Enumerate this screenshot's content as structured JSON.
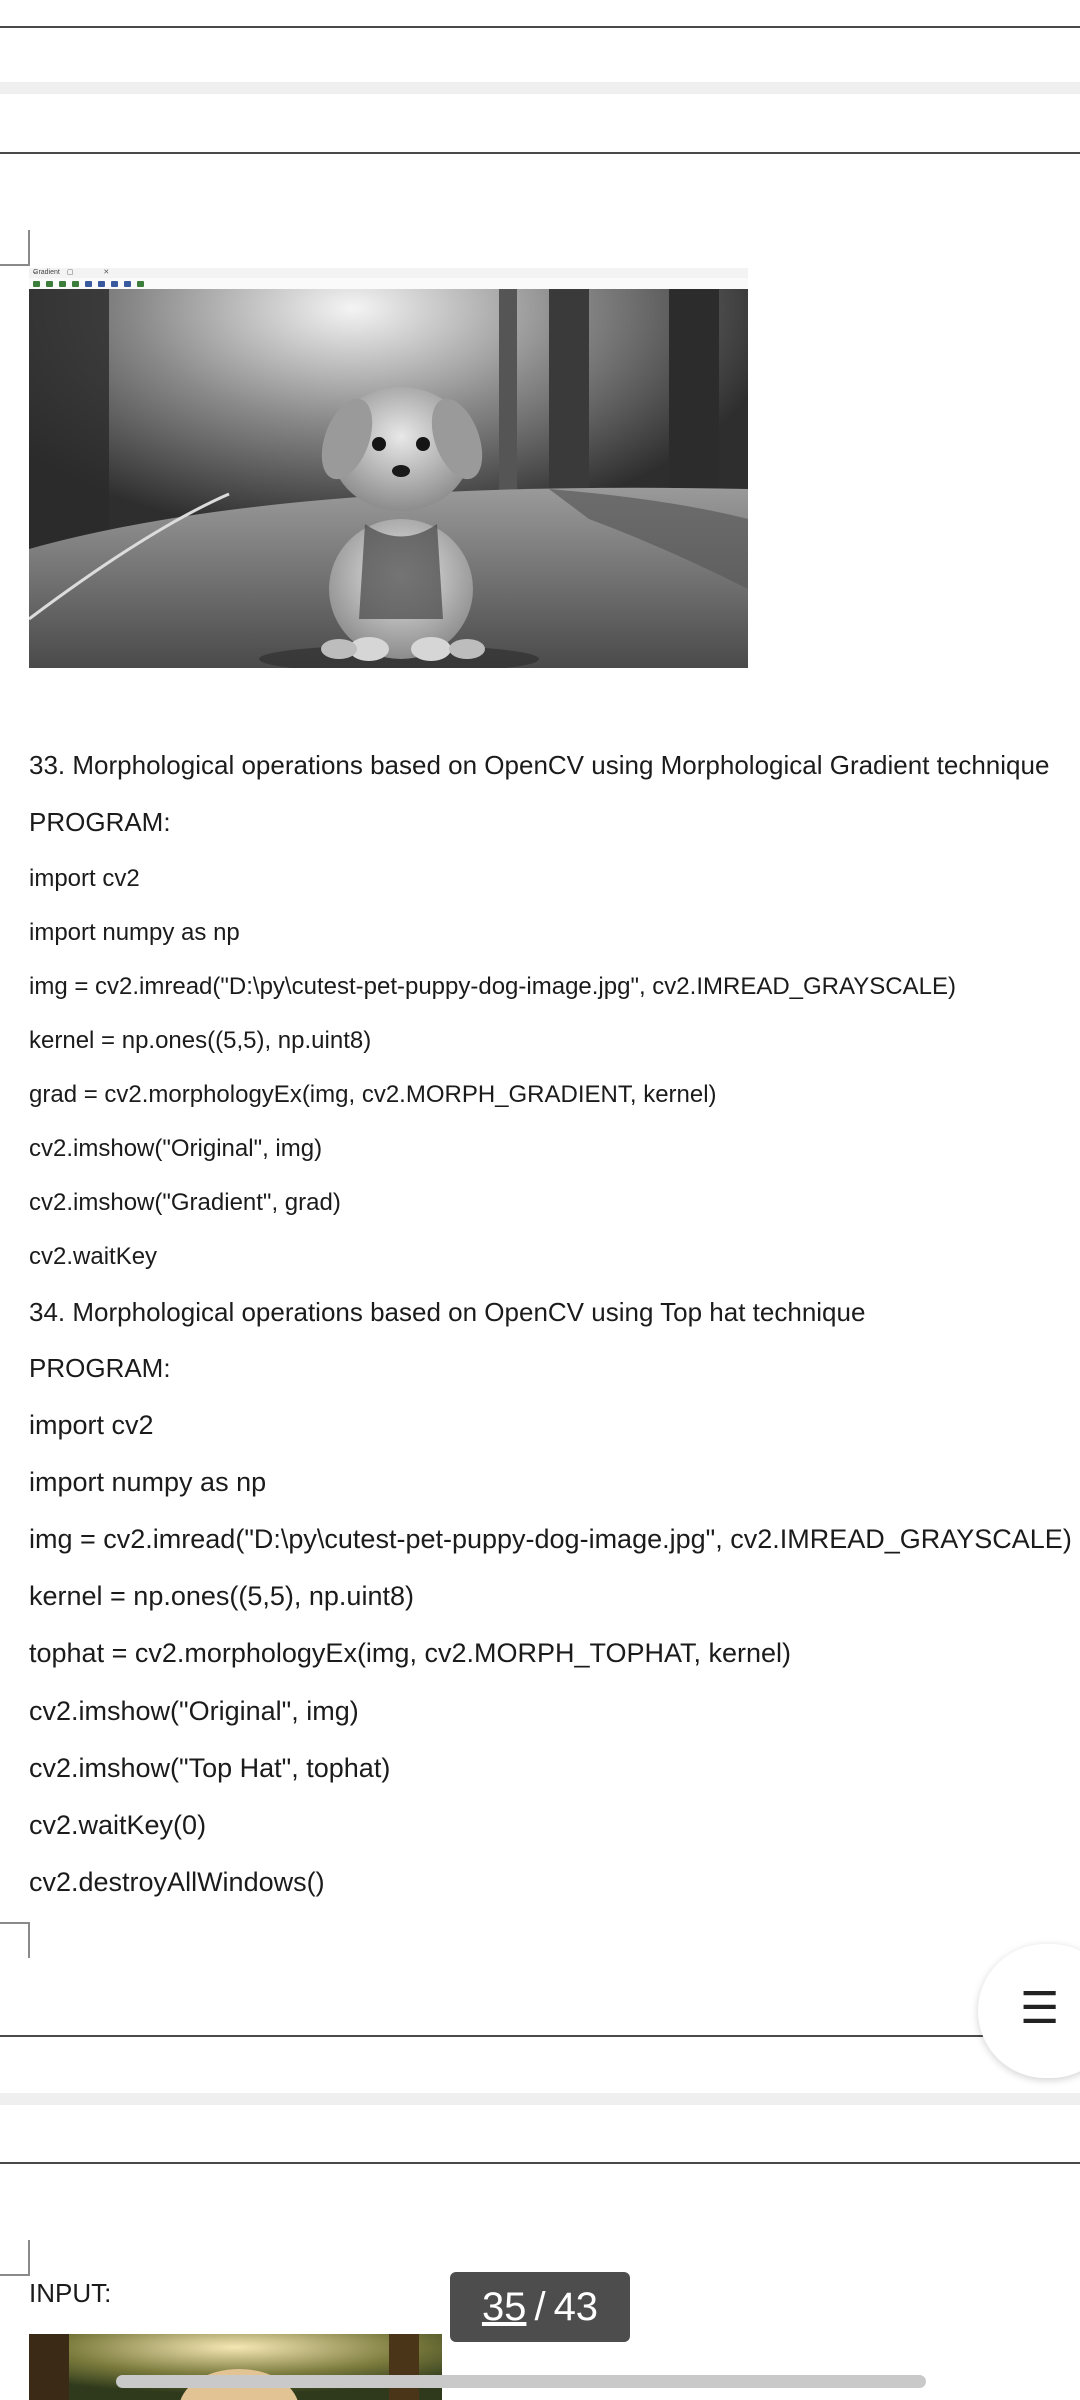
{
  "document": {
    "embedded_window_title": "Gradient",
    "embedded_window_controls": "– ▢ ✕",
    "section_33": {
      "heading": "33. Morphological operations based on OpenCV using Morphological Gradient technique",
      "program_label": "PROGRAM:",
      "code": [
        "import cv2",
        "import numpy as np",
        "img = cv2.imread(\"D:\\py\\cutest-pet-puppy-dog-image.jpg\", cv2.IMREAD_GRAYSCALE)",
        "kernel = np.ones((5,5), np.uint8)",
        "grad = cv2.morphologyEx(img, cv2.MORPH_GRADIENT, kernel)",
        "cv2.imshow(\"Original\", img)",
        "cv2.imshow(\"Gradient\", grad)",
        "cv2.waitKey"
      ]
    },
    "section_34": {
      "heading": "34. Morphological operations based on OpenCV using Top hat technique",
      "program_label": "PROGRAM:",
      "code": [
        "import cv2",
        "import numpy as np",
        "img = cv2.imread(\"D:\\py\\cutest-pet-puppy-dog-image.jpg\", cv2.IMREAD_GRAYSCALE)",
        "kernel = np.ones((5,5), np.uint8)",
        "tophat = cv2.morphologyEx(img, cv2.MORPH_TOPHAT, kernel)",
        "cv2.imshow(\"Original\", img)",
        "cv2.imshow(\"Top Hat\", tophat)",
        "cv2.waitKey(0)",
        "cv2.destroyAllWindows()"
      ]
    },
    "next_page_label": "INPUT:"
  },
  "viewer": {
    "menu_icon": "hamburger-menu-icon",
    "menu_glyph": "☰",
    "page_current": "35",
    "page_separator": "/",
    "page_total": "43"
  },
  "colors": {
    "page_background": "#ffffff",
    "page_gap": "#efefef",
    "pager_background": "#4d4d4d",
    "text": "#1b1b1b"
  }
}
